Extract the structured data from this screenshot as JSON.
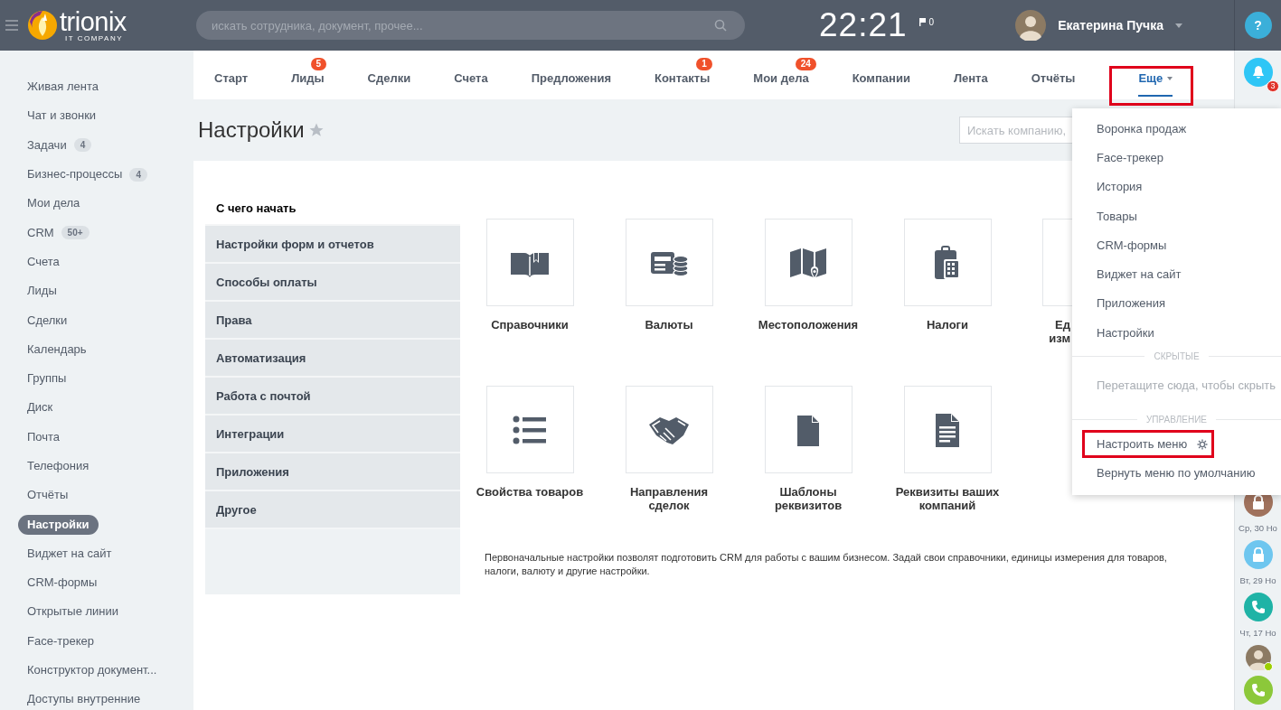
{
  "header": {
    "logo": {
      "name": "trionix",
      "tagline": "IT COMPANY"
    },
    "search": {
      "placeholder": "искать сотрудника, документ, прочее..."
    },
    "clock": "22:21",
    "flag_count": "0",
    "user": {
      "name": "Екатерина Пучка"
    },
    "help": "?"
  },
  "sidebar": {
    "items": [
      {
        "label": "Живая лента",
        "selected": false
      },
      {
        "label": "Чат и звонки",
        "selected": false
      },
      {
        "label": "Задачи",
        "count": "4",
        "selected": false
      },
      {
        "label": "Бизнес-процессы",
        "count": "4",
        "selected": false
      },
      {
        "label": "Мои дела",
        "selected": false
      },
      {
        "label": "CRM",
        "count": "50+",
        "selected": false
      },
      {
        "label": "Счета",
        "selected": false
      },
      {
        "label": "Лиды",
        "selected": false
      },
      {
        "label": "Сделки",
        "selected": false
      },
      {
        "label": "Календарь",
        "selected": false
      },
      {
        "label": "Группы",
        "selected": false
      },
      {
        "label": "Диск",
        "selected": false
      },
      {
        "label": "Почта",
        "selected": false
      },
      {
        "label": "Телефония",
        "selected": false
      },
      {
        "label": "Отчёты",
        "selected": false
      },
      {
        "label": "Настройки",
        "selected": true
      },
      {
        "label": "Виджет на сайт",
        "selected": false
      },
      {
        "label": "CRM-формы",
        "selected": false
      },
      {
        "label": "Открытые линии",
        "selected": false
      },
      {
        "label": "Face-трекер",
        "selected": false
      },
      {
        "label": "Конструктор документ...",
        "selected": false
      },
      {
        "label": "Доступы внутренние",
        "selected": false
      }
    ]
  },
  "tabs": [
    {
      "label": "Старт",
      "selected": false,
      "highlighted": false
    },
    {
      "label": "Лиды",
      "badge": "5",
      "selected": false,
      "highlighted": false
    },
    {
      "label": "Сделки",
      "selected": false,
      "highlighted": false
    },
    {
      "label": "Счета",
      "selected": false,
      "highlighted": false
    },
    {
      "label": "Предложения",
      "selected": false,
      "highlighted": false
    },
    {
      "label": "Контакты",
      "badge": "1",
      "selected": false,
      "highlighted": false
    },
    {
      "label": "Мои дела",
      "badge": "24",
      "selected": false,
      "highlighted": false
    },
    {
      "label": "Компании",
      "selected": false,
      "highlighted": false
    },
    {
      "label": "Лента",
      "selected": false,
      "highlighted": false
    },
    {
      "label": "Отчёты",
      "selected": false,
      "highlighted": false
    },
    {
      "label": "Еще",
      "selected": true,
      "highlighted": true
    }
  ],
  "page": {
    "title": "Настройки",
    "search": {
      "placeholder": "Искать компанию,"
    }
  },
  "settings_nav": {
    "items": [
      {
        "label": "С чего начать",
        "selected": true
      },
      {
        "label": "Настройки форм и отчетов",
        "selected": false
      },
      {
        "label": "Способы оплаты",
        "selected": false
      },
      {
        "label": "Права",
        "selected": false
      },
      {
        "label": "Автоматизация",
        "selected": false
      },
      {
        "label": "Работа с почтой",
        "selected": false
      },
      {
        "label": "Интеграции",
        "selected": false
      },
      {
        "label": "Приложения",
        "selected": false
      },
      {
        "label": "Другое",
        "selected": false
      }
    ]
  },
  "tiles": [
    {
      "kind": "book",
      "label": "Справочники"
    },
    {
      "kind": "money",
      "label": "Валюты"
    },
    {
      "kind": "map",
      "label": "Местоположения"
    },
    {
      "kind": "calculator",
      "label": "Налоги"
    },
    {
      "kind": "partial",
      "label": "Ед\nизм"
    },
    {
      "kind": "list",
      "label": "Свойства товаров"
    },
    {
      "kind": "handshake",
      "label": "Направления\nсделок"
    },
    {
      "kind": "file",
      "label": "Шаблоны\nреквизитов"
    },
    {
      "kind": "document",
      "label": "Реквизиты ваших\nкомпаний"
    }
  ],
  "description": "Первоначальные настройки позволят подготовить CRM для работы с вашим бизнесом. Задай свои справочники, единицы измерения для товаров, налоги, валюту и другие настройки.",
  "more_menu": {
    "items": [
      "Воронка продаж",
      "Face-трекер",
      "История",
      "Товары",
      "CRM-формы",
      "Виджет на сайт",
      "Приложения",
      "Настройки"
    ],
    "hidden_heading": "СКРЫТЫЕ",
    "hidden_hint": "Перетащите сюда, чтобы скрыть",
    "manage_heading": "УПРАВЛЕНИЕ",
    "manage_items": [
      {
        "label": "Настроить меню",
        "kind": "settings",
        "highlighted": true
      },
      {
        "label": "Вернуть меню по умолчанию",
        "kind": "plain",
        "highlighted": false
      }
    ]
  },
  "right_bar": {
    "notifications": "3",
    "feed": [
      {
        "kind": "lock",
        "color": "#a0725d",
        "date": "Ср, 30 Но"
      },
      {
        "kind": "lock",
        "color": "#6ec6ef",
        "date": "Вт, 29 Но"
      },
      {
        "kind": "phone",
        "color": "#1fb3a6",
        "date": "Чт, 17 Но"
      },
      {
        "kind": "avatar"
      },
      {
        "kind": "phone",
        "color": "#8cc83a"
      }
    ]
  }
}
